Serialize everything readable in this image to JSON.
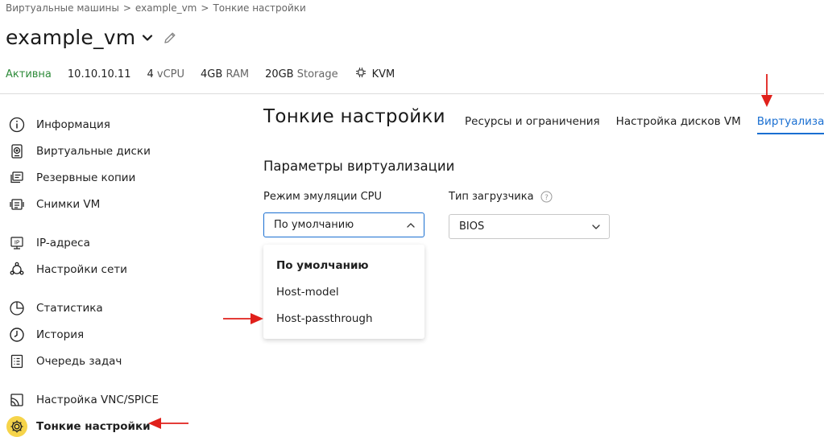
{
  "breadcrumb": {
    "items": [
      "Виртуальные машины",
      "example_vm",
      "Тонкие настройки"
    ],
    "separator": ">"
  },
  "vm": {
    "name": "example_vm",
    "status": "Активна",
    "ip": "10.10.10.11",
    "cpu_value": "4",
    "cpu_unit": "vCPU",
    "ram_value": "4GB",
    "ram_unit": "RAM",
    "storage_value": "20GB",
    "storage_unit": "Storage",
    "hypervisor": "KVM"
  },
  "sidebar": {
    "groups": [
      [
        {
          "label": "Информация",
          "icon": "info-icon"
        },
        {
          "label": "Виртуальные диски",
          "icon": "disk-icon"
        },
        {
          "label": "Резервные копии",
          "icon": "backup-icon"
        },
        {
          "label": "Снимки VM",
          "icon": "snapshot-icon"
        }
      ],
      [
        {
          "label": "IP-адреса",
          "icon": "ip-icon"
        },
        {
          "label": "Настройки сети",
          "icon": "network-icon"
        }
      ],
      [
        {
          "label": "Статистика",
          "icon": "pie-chart-icon"
        },
        {
          "label": "История",
          "icon": "clock-icon"
        },
        {
          "label": "Очередь задач",
          "icon": "task-queue-icon"
        }
      ],
      [
        {
          "label": "Настройка VNC/SPICE",
          "icon": "vnc-icon"
        },
        {
          "label": "Тонкие настройки",
          "icon": "gear-icon",
          "active": true
        }
      ]
    ]
  },
  "page": {
    "title": "Тонкие настройки"
  },
  "tabs": [
    {
      "label": "Ресурсы и ограничения"
    },
    {
      "label": "Настройка дисков VM"
    },
    {
      "label": "Виртуализация",
      "active": true
    }
  ],
  "section": {
    "title": "Параметры виртуализации"
  },
  "cpu_mode": {
    "label": "Режим эмуляции CPU",
    "value": "По умолчанию",
    "options": [
      "По умолчанию",
      "Host-model",
      "Host-passthrough"
    ],
    "selected_index": 0
  },
  "bootloader": {
    "label": "Тип загрузчика",
    "value": "BIOS"
  },
  "colors": {
    "accent": "#1a6fd1",
    "active_status": "#2e8b3a",
    "active_icon_bg": "#f6d44a",
    "annotation_arrow": "#e0201b"
  }
}
